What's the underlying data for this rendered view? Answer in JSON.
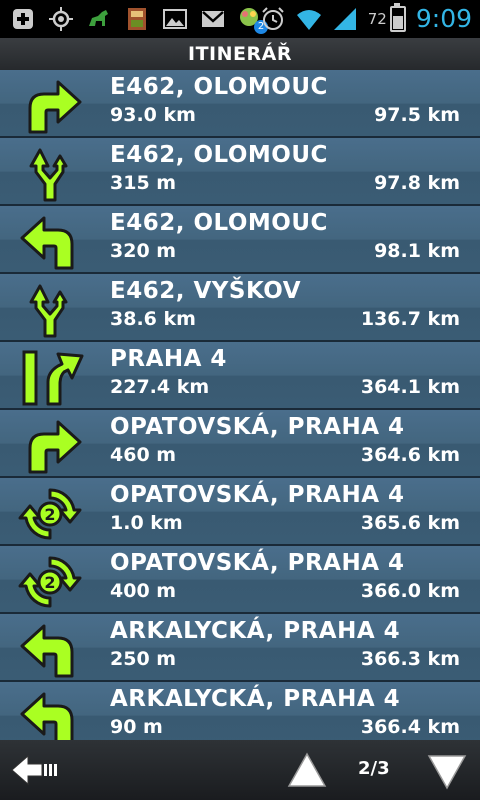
{
  "status_bar": {
    "icons": [
      "add-icon",
      "gps-icon",
      "app-animal-icon",
      "app-book-icon",
      "gallery-icon",
      "gmail-icon",
      "chat-icon"
    ],
    "notification_badge": "2",
    "battery_percent": "72",
    "time": "9:09"
  },
  "title": "ITINERÁŘ",
  "rows": [
    {
      "icon": "turn-right-icon",
      "name": "E462, OLOMOUC",
      "distance": "93.0 km",
      "total": "97.5 km"
    },
    {
      "icon": "keep-left-fork-icon",
      "name": "E462, OLOMOUC",
      "distance": "315 m",
      "total": "97.8 km"
    },
    {
      "icon": "turn-left-icon",
      "name": "E462, OLOMOUC",
      "distance": "320 m",
      "total": "98.1 km"
    },
    {
      "icon": "keep-left-fork-icon",
      "name": "E462, VYŠKOV",
      "distance": "38.6 km",
      "total": "136.7 km"
    },
    {
      "icon": "lane-bear-right-icon",
      "name": "PRAHA 4",
      "distance": "227.4 km",
      "total": "364.1 km"
    },
    {
      "icon": "turn-right-icon",
      "name": "OPATOVSKÁ, PRAHA 4",
      "distance": "460 m",
      "total": "364.6 km"
    },
    {
      "icon": "roundabout-exit-2-icon",
      "name": "OPATOVSKÁ, PRAHA 4",
      "distance": "1.0 km",
      "total": "365.6 km"
    },
    {
      "icon": "roundabout-exit-2-icon",
      "name": "OPATOVSKÁ, PRAHA 4",
      "distance": "400 m",
      "total": "366.0 km"
    },
    {
      "icon": "turn-left-icon",
      "name": "ARKALYCKÁ, PRAHA 4",
      "distance": "250 m",
      "total": "366.3 km"
    },
    {
      "icon": "turn-left-icon",
      "name": "ARKALYCKÁ, PRAHA 4",
      "distance": "90 m",
      "total": "366.4 km"
    }
  ],
  "bottom_bar": {
    "page": "2/3",
    "back_icon": "back-arrow-icon",
    "up_icon": "page-up-icon",
    "down_icon": "page-down-icon"
  },
  "colors": {
    "arrow_green": "#aaff22",
    "row_blue": "#43667f",
    "clock_blue": "#33b5e5"
  }
}
